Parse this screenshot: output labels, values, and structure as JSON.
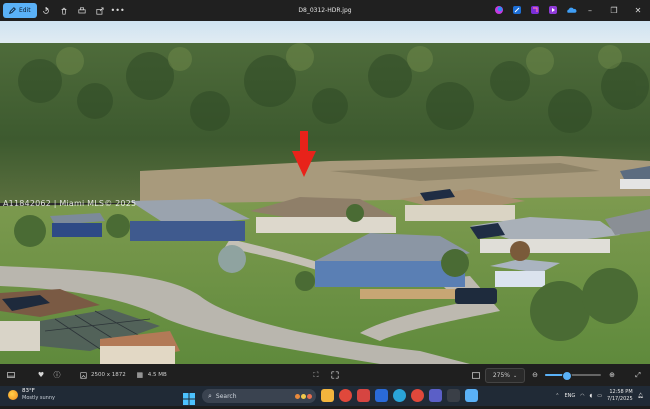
{
  "titlebar": {
    "edit_label": "Edit",
    "file_name": "D8_0312-HDR.jpg",
    "window_controls": [
      "minimize",
      "maximize",
      "close"
    ]
  },
  "photo": {
    "watermark": "A11842062 | Miami MLS© 2025",
    "marker_color": "#e8221a"
  },
  "statusbar": {
    "dimensions": "2500 x 1872",
    "file_size": "4.5 MB",
    "zoom_value": "275%",
    "zoom_slider_level": 0.38
  },
  "taskbar": {
    "weather_temp": "83°F",
    "weather_condition": "Mostly sunny",
    "search_placeholder": "Search",
    "language": "ENG",
    "time": "12:58 PM",
    "date": "7/17/2025"
  },
  "colors": {
    "accent": "#5ab1f7",
    "titlebar_bg": "#202020",
    "taskbar_bg": "#202a36"
  }
}
